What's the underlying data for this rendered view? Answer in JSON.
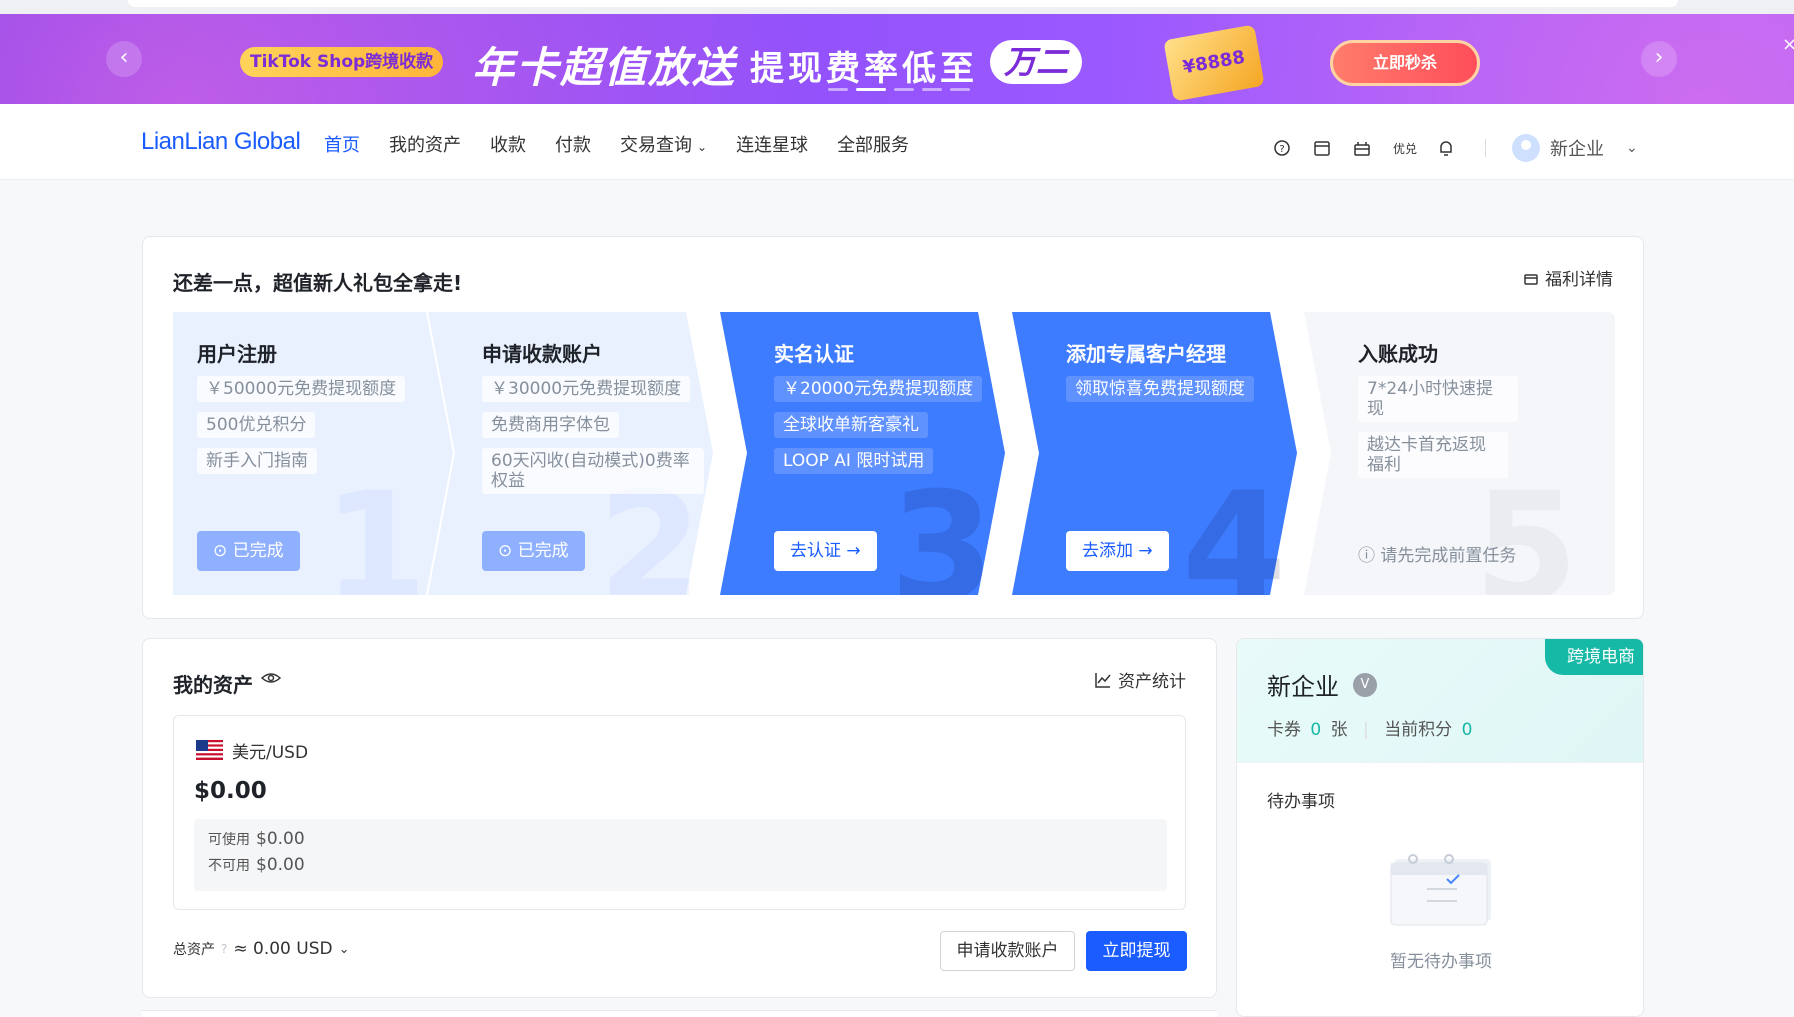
{
  "banner": {
    "tiktok_tag": "TikTok Shop跨境收款",
    "headline": "年卡超值放送",
    "subhead": "提现费率低至",
    "highlight": "万二",
    "ticket_amount": "¥8888",
    "cta": "立即秒杀",
    "prev_icon": "chevron-left-icon",
    "next_icon": "chevron-right-icon",
    "close_icon": "close-icon",
    "slide_count": 6,
    "active_slide": 2
  },
  "nav": {
    "logo": "LianLian Global",
    "items": [
      {
        "label": "首页",
        "active": true
      },
      {
        "label": "我的资产"
      },
      {
        "label": "收款"
      },
      {
        "label": "付款"
      },
      {
        "label": "交易查询",
        "dropdown": true
      },
      {
        "label": "连连星球"
      },
      {
        "label": "全部服务"
      }
    ],
    "icons": [
      "help-icon",
      "calendar-icon",
      "gift-icon"
    ],
    "icon_text": "优兑",
    "bell_icon": "bell-icon",
    "user_name": "新企业"
  },
  "onboarding": {
    "title": "还差一点，超值新人礼包全拿走!",
    "benefit_link": "福利详情",
    "steps": [
      {
        "num": "1",
        "title": "用户注册",
        "tags": [
          "￥50000元免费提现额度",
          "500优兑积分",
          "新手入门指南"
        ],
        "status": "已完成"
      },
      {
        "num": "2",
        "title": "申请收款账户",
        "tags": [
          "￥30000元免费提现额度",
          "免费商用字体包",
          "60天闪收(自动模式)0费率权益"
        ],
        "status": "已完成"
      },
      {
        "num": "3",
        "title": "实名认证",
        "tags": [
          "￥20000元免费提现额度",
          "全球收单新客豪礼",
          "LOOP AI 限时试用"
        ],
        "action": "去认证 →"
      },
      {
        "num": "4",
        "title": "添加专属客户经理",
        "tags": [
          "领取惊喜免费提现额度"
        ],
        "action": "去添加 →"
      },
      {
        "num": "5",
        "title": "入账成功",
        "tags": [
          "7*24小时快速提现",
          "越达卡首充返现福利"
        ],
        "hint": "请先完成前置任务"
      }
    ]
  },
  "assets": {
    "title": "我的资产",
    "stats_link": "资产统计",
    "currency": "美元/USD",
    "amount": "$0.00",
    "available_label": "可使用",
    "available_value": "$0.00",
    "unavailable_label": "不可用",
    "unavailable_value": "$0.00",
    "total_label": "总资产",
    "total_value": "≈ 0.00 USD",
    "apply_button": "申请收款账户",
    "withdraw_button": "立即提现"
  },
  "profile": {
    "tag": "跨境电商",
    "company": "新企业",
    "badge": "V",
    "coupon_label": "卡券",
    "coupon_value": "0",
    "coupon_unit": "张",
    "points_label": "当前积分",
    "points_value": "0",
    "todo_title": "待办事项",
    "todo_empty": "暂无待办事项"
  },
  "colors": {
    "primary": "#1a5cff",
    "banner": "#8b4cf7",
    "teal": "#16b8a6"
  }
}
